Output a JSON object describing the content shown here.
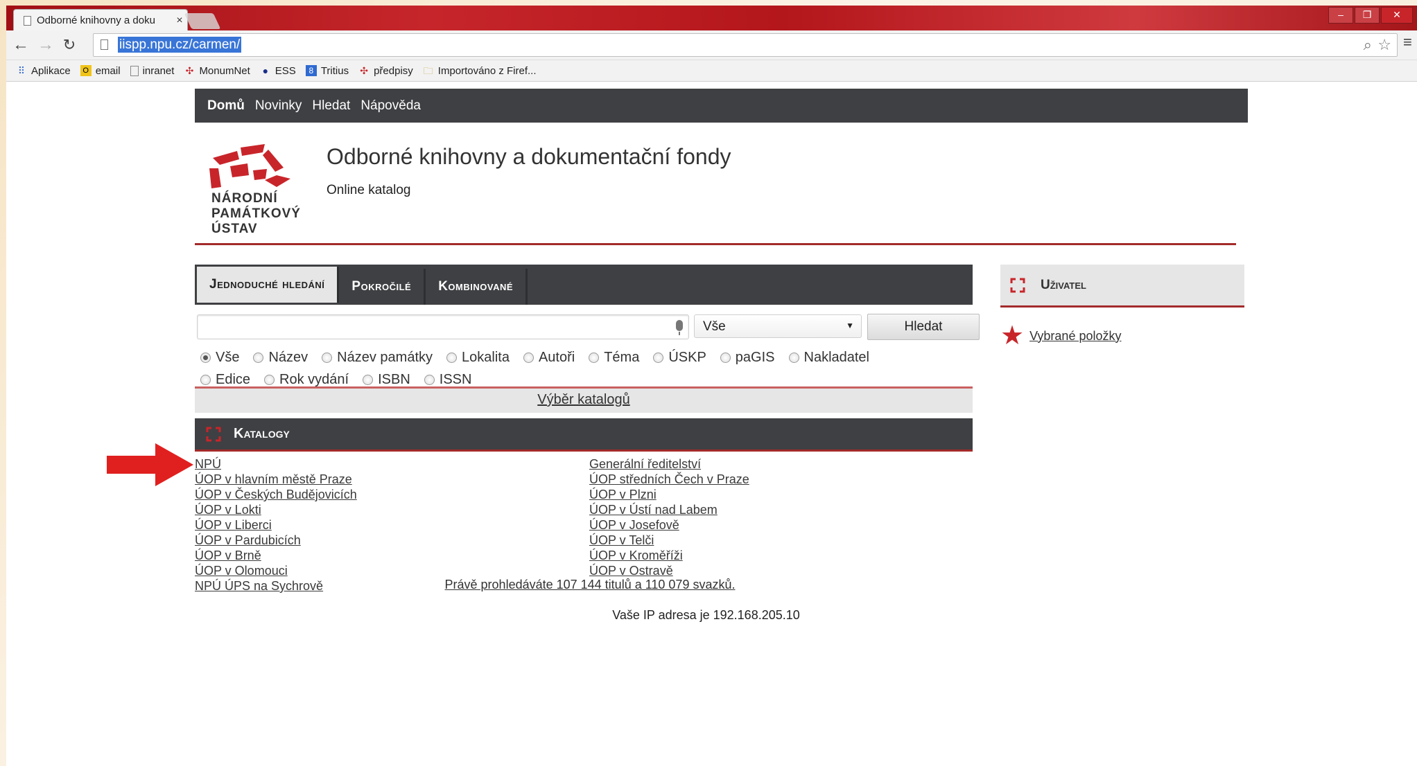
{
  "browser": {
    "tab_title": "Odborné knihovny a doku",
    "url": "iispp.npu.cz/carmen/",
    "bookmarks": [
      "Aplikace",
      "email",
      "inranet",
      "MonumNet",
      "ESS",
      "Tritius",
      "předpisy",
      "Importováno z Firef..."
    ]
  },
  "nav": {
    "items": [
      "Domů",
      "Novinky",
      "Hledat",
      "Nápověda"
    ]
  },
  "header": {
    "logo_lines": [
      "NÁRODNÍ",
      "PAMÁTKOVÝ",
      "ÚSTAV"
    ],
    "title": "Odborné knihovny a dokumentační fondy",
    "subtitle": "Online katalog"
  },
  "search": {
    "tabs": [
      "Jednoduché hledání",
      "Pokročilé",
      "Kombinované"
    ],
    "scope_value": "Vše",
    "button_label": "Hledat",
    "radios_row1": [
      "Vše",
      "Název",
      "Název památky",
      "Lokalita",
      "Autoři",
      "Téma",
      "ÚSKP",
      "paGIS",
      "Nakladatel"
    ],
    "radios_row2": [
      "Edice",
      "Rok vydání",
      "ISBN",
      "ISSN"
    ],
    "selected_radio": "Vše",
    "catalog_select": "Výběr katalogů"
  },
  "catalogs": {
    "header": "Katalogy",
    "left": [
      "NPÚ",
      "ÚOP v hlavním městě Praze",
      "ÚOP v Českých Budějovicích",
      "ÚOP v Lokti",
      "ÚOP v Liberci",
      "ÚOP v Pardubicích",
      "ÚOP v Brně",
      "ÚOP v Olomouci",
      "NPÚ ÚPS na Sychrově"
    ],
    "right": [
      "Generální ředitelství",
      "ÚOP středních Čech v Praze",
      "ÚOP v Plzni",
      "ÚOP v Ústí nad Labem",
      "ÚOP v Josefově",
      "ÚOP v Telči",
      "ÚOP v Kroměříži",
      "ÚOP v Ostravě"
    ]
  },
  "footer": {
    "stats": "Právě prohledáváte 107 144 titulů a 110 079 svazků.",
    "ip": "Vaše IP adresa je 192.168.205.10"
  },
  "user": {
    "header": "Uživatel",
    "selected_items": "Vybrané položky"
  },
  "colors": {
    "dark": "#3f4043",
    "accent": "#a32a2a",
    "arrow": "#e0201f"
  }
}
